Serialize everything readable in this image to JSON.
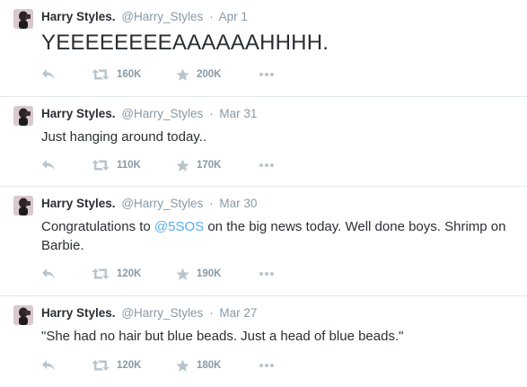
{
  "colors": {
    "link": "#55acee",
    "muted": "#8899a6",
    "text": "#292f33",
    "divider": "#e1e8ed"
  },
  "tweets": [
    {
      "fullname": "Harry Styles.",
      "username": "@Harry_Styles",
      "separator": "·",
      "time": "Apr 1",
      "text_parts": [
        "YEEEEEEEEAAAAAAHHHH.",
        "",
        ""
      ],
      "retweets": "160K",
      "favorites": "200K",
      "icons": [
        "reply-icon",
        "retweet-icon",
        "star-icon",
        "more-icon"
      ]
    },
    {
      "fullname": "Harry Styles.",
      "username": "@Harry_Styles",
      "separator": "·",
      "time": "Mar 31",
      "text_parts": [
        "Just hanging around today..",
        "",
        ""
      ],
      "retweets": "110K",
      "favorites": "170K",
      "icons": [
        "reply-icon",
        "retweet-icon",
        "star-icon",
        "more-icon"
      ]
    },
    {
      "fullname": "Harry Styles.",
      "username": "@Harry_Styles",
      "separator": "·",
      "time": "Mar 30",
      "text_parts": [
        "Congratulations to ",
        "@5SOS",
        " on the big news today. Well done boys. Shrimp on Barbie."
      ],
      "retweets": "120K",
      "favorites": "190K",
      "icons": [
        "reply-icon",
        "retweet-icon",
        "star-icon",
        "more-icon"
      ]
    },
    {
      "fullname": "Harry Styles.",
      "username": "@Harry_Styles",
      "separator": "·",
      "time": "Mar 27",
      "text_parts": [
        "\"She had no hair but blue beads. Just a head of blue beads.\"",
        "",
        ""
      ],
      "retweets": "120K",
      "favorites": "180K",
      "icons": [
        "reply-icon",
        "retweet-icon",
        "star-icon",
        "more-icon"
      ]
    }
  ]
}
